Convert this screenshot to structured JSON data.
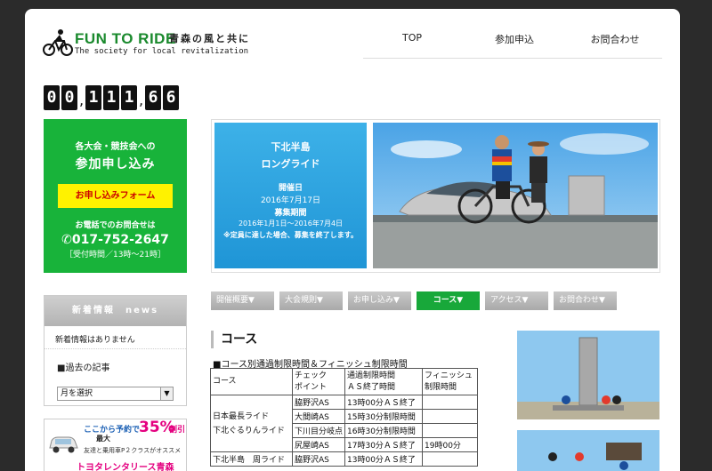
{
  "header": {
    "logo_title": "FUN TO RIDE",
    "logo_subtitle_jp": "青森の風と共に",
    "logo_tagline": "The society for local revitalization",
    "nav": [
      {
        "label": "TOP"
      },
      {
        "label": "参加申込"
      },
      {
        "label": "お問合わせ"
      }
    ]
  },
  "counter": {
    "digits": [
      "0",
      "0",
      "1",
      "1",
      "1",
      "6",
      "6"
    ]
  },
  "entry_box": {
    "line1": "各大会・競技会への",
    "line2": "参加申し込み",
    "button_label": "お申し込みフォーム",
    "phone_heading": "お電話でのお問合せは",
    "phone": "017-752-2647",
    "hours": "［受付時間／13時～21時］"
  },
  "news": {
    "heading": "新着情報　news",
    "empty_text": "新着情報はありません",
    "past_label": "■過去の記事",
    "select_value": "月を選択"
  },
  "banner": {
    "line1": "ここから予約で",
    "percent": "35%",
    "off_label": "割引",
    "max_label": "最大",
    "line2": "友達と乗用車P２クラスがオススメ",
    "brand": "トヨタレンタリース青森"
  },
  "hero": {
    "title_line1": "下北半島",
    "title_line2": "ロングライド",
    "date_label": "開催日",
    "date": "2016年7月17日",
    "period_label": "募集期間",
    "period": "2016年1月1日～2016年7月4日",
    "note": "※定員に達した場合、募集を終了します。"
  },
  "subnav": [
    {
      "label": "開催概要▼"
    },
    {
      "label": "大会規則▼"
    },
    {
      "label": "お申し込み▼"
    },
    {
      "label": "コース▼"
    },
    {
      "label": "アクセス▼"
    },
    {
      "label": "お問合わせ▼"
    }
  ],
  "content": {
    "section_title": "コース",
    "section_sub": "■コース別通過制限時間＆フィニッシュ制限時間",
    "table_headers": [
      "コース",
      "チェック\nポイント",
      "通過制限時間\nＡＳ終了時間",
      "フィニッシュ\n制限時間"
    ],
    "course_1_name": "日本最長ライド\n下北ぐるりんライド",
    "rows": [
      {
        "point": "脇野沢AS",
        "time": "13時00分ＡＳ終了",
        "finish": ""
      },
      {
        "point": "大間崎AS",
        "time": "15時30分制限時間",
        "finish": ""
      },
      {
        "point": "下川目分岐点",
        "time": "16時30分制限時間",
        "finish": ""
      },
      {
        "point": "尻屋崎AS",
        "time": "17時30分ＡＳ終了",
        "finish": "19時00分"
      },
      {
        "point": "脇野沢AS",
        "time": "13時00分ＡＳ終了",
        "finish": ""
      }
    ],
    "course_2_name": "下北半島　周ライド"
  }
}
